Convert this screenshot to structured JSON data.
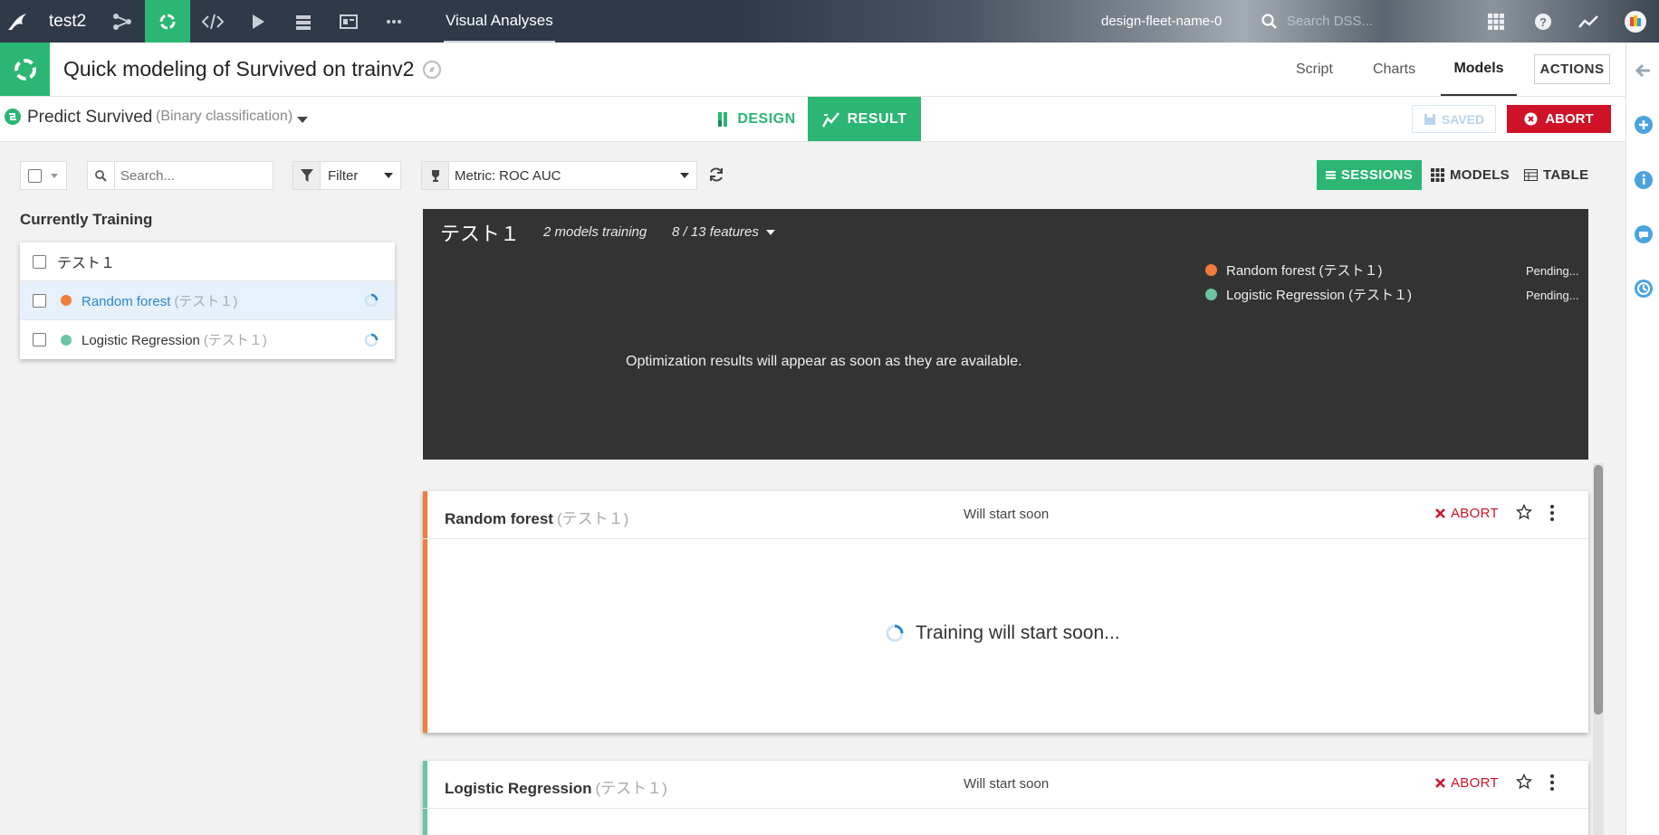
{
  "topnav": {
    "project": "test2",
    "current_section": "Visual Analyses",
    "instance_name": "design-fleet-name-0",
    "search_placeholder": "Search DSS..."
  },
  "header": {
    "title": "Quick modeling of Survived on trainv2",
    "tabs": [
      "Script",
      "Charts",
      "Models"
    ],
    "active_tab": "Models",
    "actions_label": "ACTIONS"
  },
  "subheader": {
    "task_name": "Predict Survived",
    "task_type": "(Binary classification)",
    "design_label": "DESIGN",
    "result_label": "RESULT",
    "saved_label": "SAVED",
    "abort_label": "ABORT"
  },
  "toolbar": {
    "search_placeholder": "Search...",
    "filter_label": "Filter",
    "metric_label": "Metric: ROC AUC",
    "views": [
      "SESSIONS",
      "MODELS",
      "TABLE"
    ],
    "active_view": "SESSIONS"
  },
  "training": {
    "title": "Currently Training",
    "session": "テスト１",
    "models": [
      {
        "name": "Random forest",
        "session": "(テスト１)",
        "color": "#f07c3d"
      },
      {
        "name": "Logistic Regression",
        "session": "(テスト１)",
        "color": "#6cc4a2"
      }
    ]
  },
  "session_panel": {
    "title": "テスト１",
    "models_training": "2 models training",
    "features": "8 / 13 features",
    "message": "Optimization results will appear as soon as they are available.",
    "legend": [
      {
        "label": "Random forest (テスト１)",
        "status": "Pending...",
        "color": "#f07c3d"
      },
      {
        "label": "Logistic Regression (テスト１)",
        "status": "Pending...",
        "color": "#6cc4a2"
      }
    ]
  },
  "cards": [
    {
      "name": "Random forest",
      "session": "(テスト１)",
      "status": "Will start soon",
      "abort": "ABORT",
      "body": "Training will start soon...",
      "color": "#f07c3d"
    },
    {
      "name": "Logistic Regression",
      "session": "(テスト１)",
      "status": "Will start soon",
      "abort": "ABORT",
      "color": "#6cc4a2"
    }
  ],
  "colors": {
    "accent_green": "#2bb673",
    "abort_red": "#ce1329",
    "dark_panel": "#333333"
  }
}
